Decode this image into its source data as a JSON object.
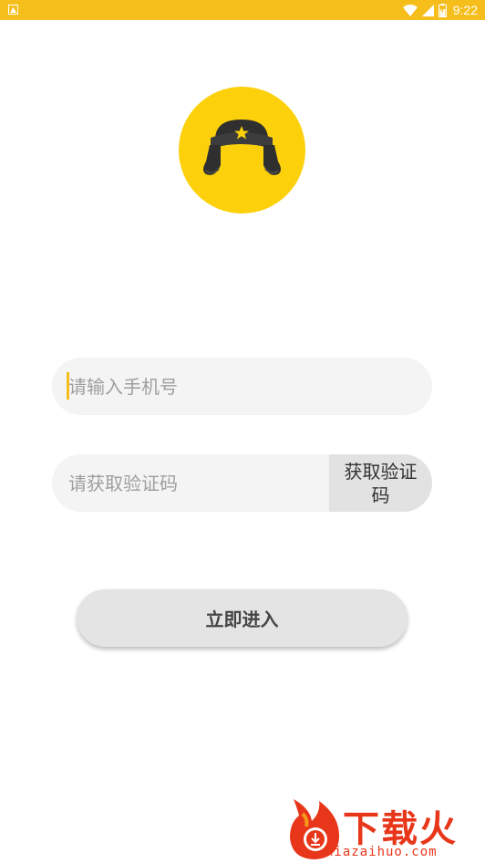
{
  "status_bar": {
    "time": "9:22",
    "color": "#f5be1b",
    "icons": [
      "notification-icon",
      "wifi-icon",
      "signal-icon",
      "battery-icon"
    ]
  },
  "logo": {
    "icon": "ushanka-hat-icon",
    "background": "#fcd00a"
  },
  "phone_field": {
    "placeholder": "请输入手机号",
    "value": ""
  },
  "code_field": {
    "placeholder": "请获取验证码",
    "value": "",
    "button_label": "获取验证码"
  },
  "submit": {
    "label": "立即进入"
  },
  "watermark": {
    "brand": "下载火",
    "url": "xiazaihuo.com"
  }
}
